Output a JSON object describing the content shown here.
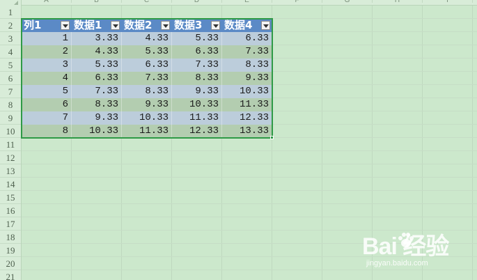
{
  "columns": [
    "A",
    "B",
    "C",
    "D",
    "E",
    "F",
    "G",
    "H",
    "I"
  ],
  "rows": [
    "1",
    "2",
    "3",
    "4",
    "5",
    "6",
    "7",
    "8",
    "9",
    "10",
    "11",
    "12",
    "13",
    "14",
    "15",
    "16",
    "17",
    "18",
    "19",
    "20",
    "21"
  ],
  "table": {
    "headers": [
      "列1",
      "数据1",
      "数据2",
      "数据3",
      "数据4"
    ],
    "body": [
      [
        "1",
        "3.33",
        "4.33",
        "5.33",
        "6.33"
      ],
      [
        "2",
        "4.33",
        "5.33",
        "6.33",
        "7.33"
      ],
      [
        "3",
        "5.33",
        "6.33",
        "7.33",
        "8.33"
      ],
      [
        "4",
        "6.33",
        "7.33",
        "8.33",
        "9.33"
      ],
      [
        "5",
        "7.33",
        "8.33",
        "9.33",
        "10.33"
      ],
      [
        "6",
        "8.33",
        "9.33",
        "10.33",
        "11.33"
      ],
      [
        "7",
        "9.33",
        "10.33",
        "11.33",
        "12.33"
      ],
      [
        "8",
        "10.33",
        "11.33",
        "12.33",
        "13.33"
      ]
    ],
    "header_color": "#5b8ac6",
    "band_colors": [
      "#bccddb",
      "#b3cdb0"
    ],
    "outline_color": "#2e9a46"
  },
  "watermark": {
    "brand": "Bai  经验",
    "url": "jingyan.baidu.com"
  },
  "sheet_bg": "#cce8cc"
}
